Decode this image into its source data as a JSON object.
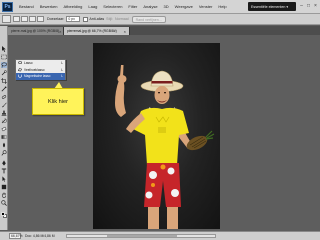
{
  "app": {
    "logo_text": "Ps"
  },
  "menubar": {
    "items": [
      "Bestand",
      "Bewerken",
      "Afbeelding",
      "Laag",
      "Selecteren",
      "Filter",
      "Analyse",
      "3D",
      "Weergave",
      "Venster",
      "Help"
    ],
    "workspace_label": "Essentiële elementen ▾",
    "window_controls": [
      "–",
      "□",
      "×"
    ]
  },
  "optionsbar": {
    "doezelaar_label": "Doezelaar:",
    "doezelaar_value": "0 px",
    "anti_alias_label": "Anti-alias",
    "stijl_label": "Stijl:",
    "stijl_value": "Normaal",
    "rand_button": "Rand verfijnen..."
  },
  "tabs": [
    {
      "label": "pierre-mal.jpg @ 100% (RGB/8)",
      "active": false
    },
    {
      "label": "pierremal.jpg @ 66,7% (RGB/8#)",
      "active": true
    }
  ],
  "flyout": {
    "items": [
      {
        "label": "Lasso",
        "shortcut": "L",
        "selected": false
      },
      {
        "label": "Veelhoeklasso",
        "shortcut": "L",
        "selected": false
      },
      {
        "label": "Magnetische lasso",
        "shortcut": "L",
        "selected": true
      }
    ]
  },
  "callout": {
    "text": "Klik hier"
  },
  "statusbar": {
    "zoom": "66,67%",
    "info": "Doc: 4,86 M/4,86 M"
  },
  "colors": {
    "accent": "#3a66b0",
    "callout": "#fff35a",
    "shirt": "#f2e21a",
    "shorts": "#c6252a"
  }
}
